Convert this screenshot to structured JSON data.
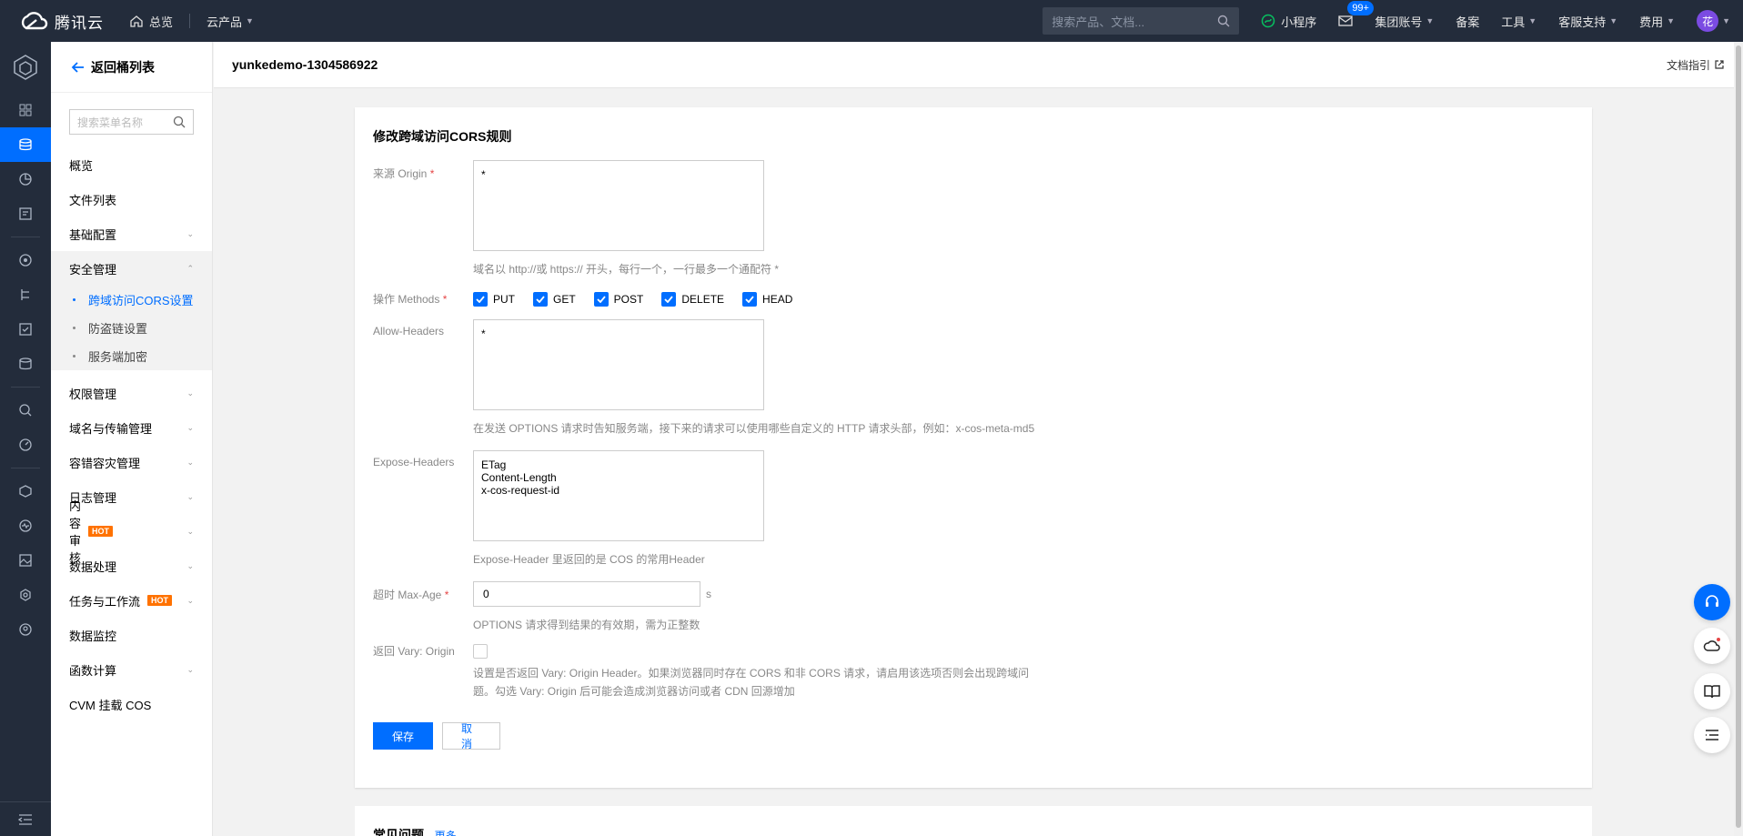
{
  "topbar": {
    "logo_text": "腾讯云",
    "overview": "总览",
    "products": "云产品",
    "search_placeholder": "搜索产品、文档...",
    "mini_program": "小程序",
    "msg_badge": "99+",
    "group_account": "集团账号",
    "filing": "备案",
    "tools": "工具",
    "support": "客服支持",
    "billing": "费用",
    "avatar_text": "花"
  },
  "sidebar": {
    "back": "返回桶列表",
    "search_placeholder": "搜索菜单名称",
    "items": {
      "overview": "概览",
      "files": "文件列表",
      "basic": "基础配置",
      "security": "安全管理",
      "security_sub": [
        "跨域访问CORS设置",
        "防盗链设置",
        "服务端加密"
      ],
      "permission": "权限管理",
      "domain": "域名与传输管理",
      "fault": "容错容灾管理",
      "log": "日志管理",
      "audit": "内容审核",
      "data_proc": "数据处理",
      "task": "任务与工作流",
      "monitor": "数据监控",
      "function": "函数计算",
      "cvm": "CVM 挂载 COS"
    },
    "hot": "HOT"
  },
  "header": {
    "bucket": "yunkedemo-1304586922",
    "doc": "文档指引"
  },
  "form": {
    "title": "修改跨域访问CORS规则",
    "origin_label": "来源 Origin",
    "origin_value": "*",
    "origin_help": "域名以 http://或 https:// 开头，每行一个，一行最多一个通配符 *",
    "methods_label": "操作 Methods",
    "methods": [
      "PUT",
      "GET",
      "POST",
      "DELETE",
      "HEAD"
    ],
    "allow_headers_label": "Allow-Headers",
    "allow_headers_value": "*",
    "allow_headers_help": "在发送 OPTIONS 请求时告知服务端，接下来的请求可以使用哪些自定义的 HTTP 请求头部，例如：x-cos-meta-md5",
    "expose_headers_label": "Expose-Headers",
    "expose_headers_value": "ETag\nContent-Length\nx-cos-request-id",
    "expose_headers_help": "Expose-Header 里返回的是 COS 的常用Header",
    "maxage_label": "超时 Max-Age",
    "maxage_value": "0",
    "maxage_unit": "s",
    "maxage_help": "OPTIONS 请求得到结果的有效期，需为正整数",
    "vary_label": "返回 Vary: Origin",
    "vary_help": "设置是否返回 Vary: Origin Header。如果浏览器同时存在 CORS 和非 CORS 请求，请启用该选项否则会出现跨域问题。勾选 Vary: Origin 后可能会造成浏览器访问或者 CDN 回源增加",
    "save": "保存",
    "cancel": "取消"
  },
  "faq": {
    "title": "常见问题",
    "more": "更多"
  }
}
